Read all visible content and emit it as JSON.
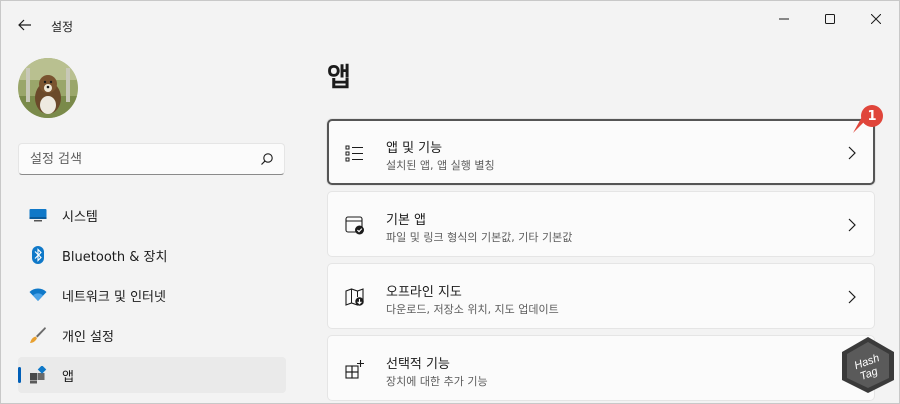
{
  "window": {
    "title": "설정",
    "controls": [
      "minimize",
      "maximize",
      "close"
    ]
  },
  "sidebar": {
    "search_placeholder": "설정 검색",
    "items": [
      {
        "label": "시스템",
        "icon": "monitor-icon",
        "active": false
      },
      {
        "label": "Bluetooth & 장치",
        "icon": "bluetooth-icon",
        "active": false
      },
      {
        "label": "네트워크 및 인터넷",
        "icon": "wifi-icon",
        "active": false
      },
      {
        "label": "개인 설정",
        "icon": "paintbrush-icon",
        "active": false
      },
      {
        "label": "앱",
        "icon": "apps-icon",
        "active": true
      }
    ]
  },
  "main": {
    "title": "앱",
    "cards": [
      {
        "title": "앱 및 기능",
        "subtitle": "설치된 앱, 앱 실행 별칭",
        "icon": "list-icon",
        "selected": true
      },
      {
        "title": "기본 앱",
        "subtitle": "파일 및 링크 형식의 기본값, 기타 기본값",
        "icon": "default-apps-icon",
        "selected": false
      },
      {
        "title": "오프라인 지도",
        "subtitle": "다운로드, 저장소 위치, 지도 업데이트",
        "icon": "map-icon",
        "selected": false
      },
      {
        "title": "선택적 기능",
        "subtitle": "장치에 대한 추가 기능",
        "icon": "add-feature-icon",
        "selected": false
      }
    ]
  },
  "annotation": {
    "number": "1",
    "color": "#e0453a"
  },
  "watermark": {
    "line1": "Hash",
    "line2": "Tag"
  },
  "colors": {
    "accent": "#005fb8",
    "background": "#f3f3f3",
    "card": "#fbfbfb"
  }
}
